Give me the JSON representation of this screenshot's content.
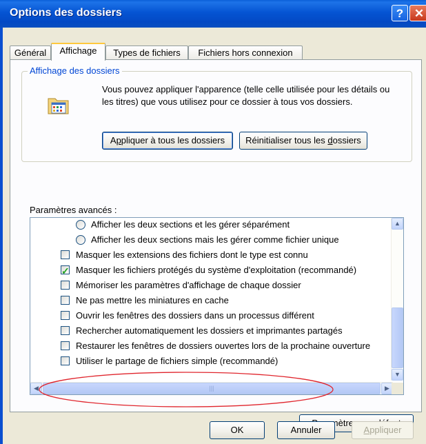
{
  "window": {
    "title": "Options des dossiers",
    "help_label": "?",
    "close_label": "✕"
  },
  "tabs": [
    {
      "label": "Général",
      "active": false
    },
    {
      "label": "Affichage",
      "active": true
    },
    {
      "label": "Types de fichiers",
      "active": false
    },
    {
      "label": "Fichiers hors connexion",
      "active": false
    }
  ],
  "folder_view": {
    "group_label": "Affichage des dossiers",
    "icon": "folder-options-icon",
    "description": "Vous pouvez appliquer l'apparence (telle celle utilisée pour les détails ou les titres) que vous utilisez pour ce dossier à tous vos dossiers.",
    "apply_all_pre": "A",
    "apply_all_mn": "p",
    "apply_all_post": "pliquer à tous les dossiers",
    "reset_all_pre": "Réinitialiser tous les ",
    "reset_all_mn": "d",
    "reset_all_post": "ossiers"
  },
  "advanced": {
    "label": "Paramètres avancés :",
    "items": [
      {
        "type": "radio",
        "text": "Afficher les deux sections et les gérer séparément",
        "checked": false
      },
      {
        "type": "radio",
        "text": "Afficher les deux sections mais les gérer comme fichier unique",
        "checked": false
      },
      {
        "type": "checkbox",
        "text": "Masquer les extensions des fichiers dont le type est connu",
        "checked": false
      },
      {
        "type": "checkbox",
        "text": "Masquer les fichiers protégés du système d'exploitation (recommandé)",
        "checked": true
      },
      {
        "type": "checkbox",
        "text": "Mémoriser les paramètres d'affichage de chaque dossier",
        "checked": false
      },
      {
        "type": "checkbox",
        "text": "Ne pas mettre les miniatures en cache",
        "checked": false
      },
      {
        "type": "checkbox",
        "text": "Ouvrir les fenêtres des dossiers dans un processus différent",
        "checked": false
      },
      {
        "type": "checkbox",
        "text": "Rechercher automatiquement les dossiers et imprimantes partagés",
        "checked": false
      },
      {
        "type": "checkbox",
        "text": "Restaurer les fenêtres de dossiers ouvertes lors de la prochaine ouverture",
        "checked": false
      },
      {
        "type": "checkbox",
        "text": "Utiliser le partage de fichiers simple (recommandé)",
        "checked": false
      }
    ],
    "highlight_color": "#e0242c"
  },
  "buttons": {
    "defaults_mn": "P",
    "defaults_post": "aramètres par défaut",
    "ok": "OK",
    "cancel": "Annuler",
    "apply_mn": "A",
    "apply_post": "ppliquer"
  },
  "scroll": {
    "up": "▲",
    "down": "▼",
    "left": "◀",
    "right": "▶",
    "grip": "|||"
  }
}
